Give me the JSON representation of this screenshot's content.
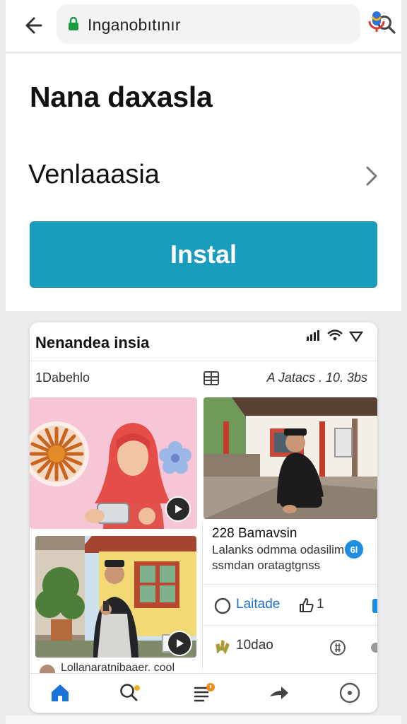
{
  "browser": {
    "url": "Inganobıtınır"
  },
  "app": {
    "title": "Nana daxasla",
    "developer": "Venlaaasia",
    "install_label": "Instal"
  },
  "preview": {
    "title": "Nenandea insia",
    "tab_left": "1Dabehlo",
    "tab_right": "A Jatacs . 10. 3bs",
    "info_title": "228 Bamavsin",
    "info_line1": "Lalanks odmma odasilim",
    "info_line2": "ssmdan oratagtgnss",
    "info_badge": "6l",
    "latest_label": "Laitade",
    "like_count": "1",
    "dao_label": "10dao",
    "caption": "Lollanaratnibaaer. cool"
  },
  "colors": {
    "install": "#1a9cbd",
    "link": "#1b6fd1",
    "lock": "#1e9b3e",
    "nav_active": "#1a73d9"
  },
  "icons": [
    "back-arrow-icon",
    "lock-icon",
    "search-icon",
    "mic-icon",
    "chevron-right-icon",
    "signal-icon",
    "wifi-icon",
    "grid-icon",
    "play-icon",
    "circle-icon",
    "thumb-up-icon",
    "share-square-icon",
    "home-icon",
    "search-dot-icon",
    "list-notification-icon",
    "forward-icon",
    "profile-circle-icon"
  ]
}
